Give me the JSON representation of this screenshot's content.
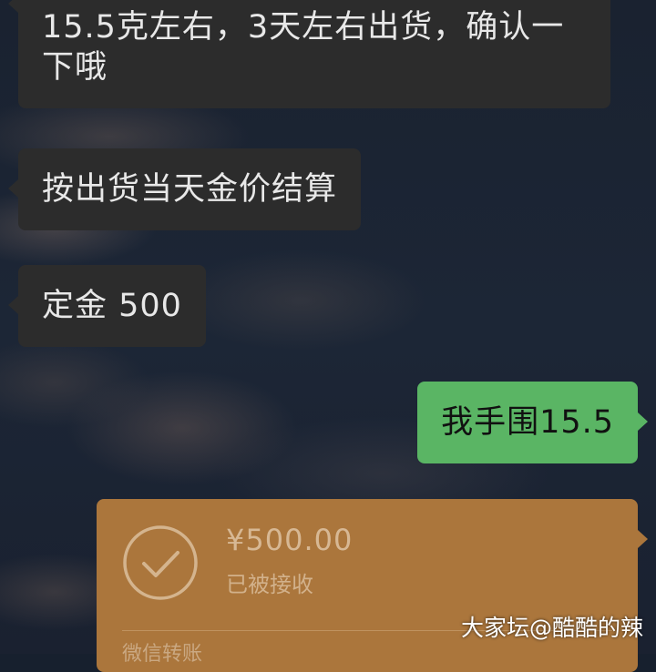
{
  "messages": [
    {
      "side": "left",
      "text": "15.5克左右，3天左右出货，确认一下哦"
    },
    {
      "side": "left",
      "text": "按出货当天金价结算"
    },
    {
      "side": "left",
      "text": "定金 500"
    },
    {
      "side": "right",
      "text": "我手围15.5"
    }
  ],
  "transfer": {
    "amount": "¥500.00",
    "status": "已被接收",
    "label": "微信转账",
    "icon": "check-circle-icon",
    "color": "#ab763c"
  },
  "watermark": "大家坛@酷酷的辣",
  "colors": {
    "incoming_bubble": "#2c2c2c",
    "outgoing_bubble": "#5ab564"
  }
}
